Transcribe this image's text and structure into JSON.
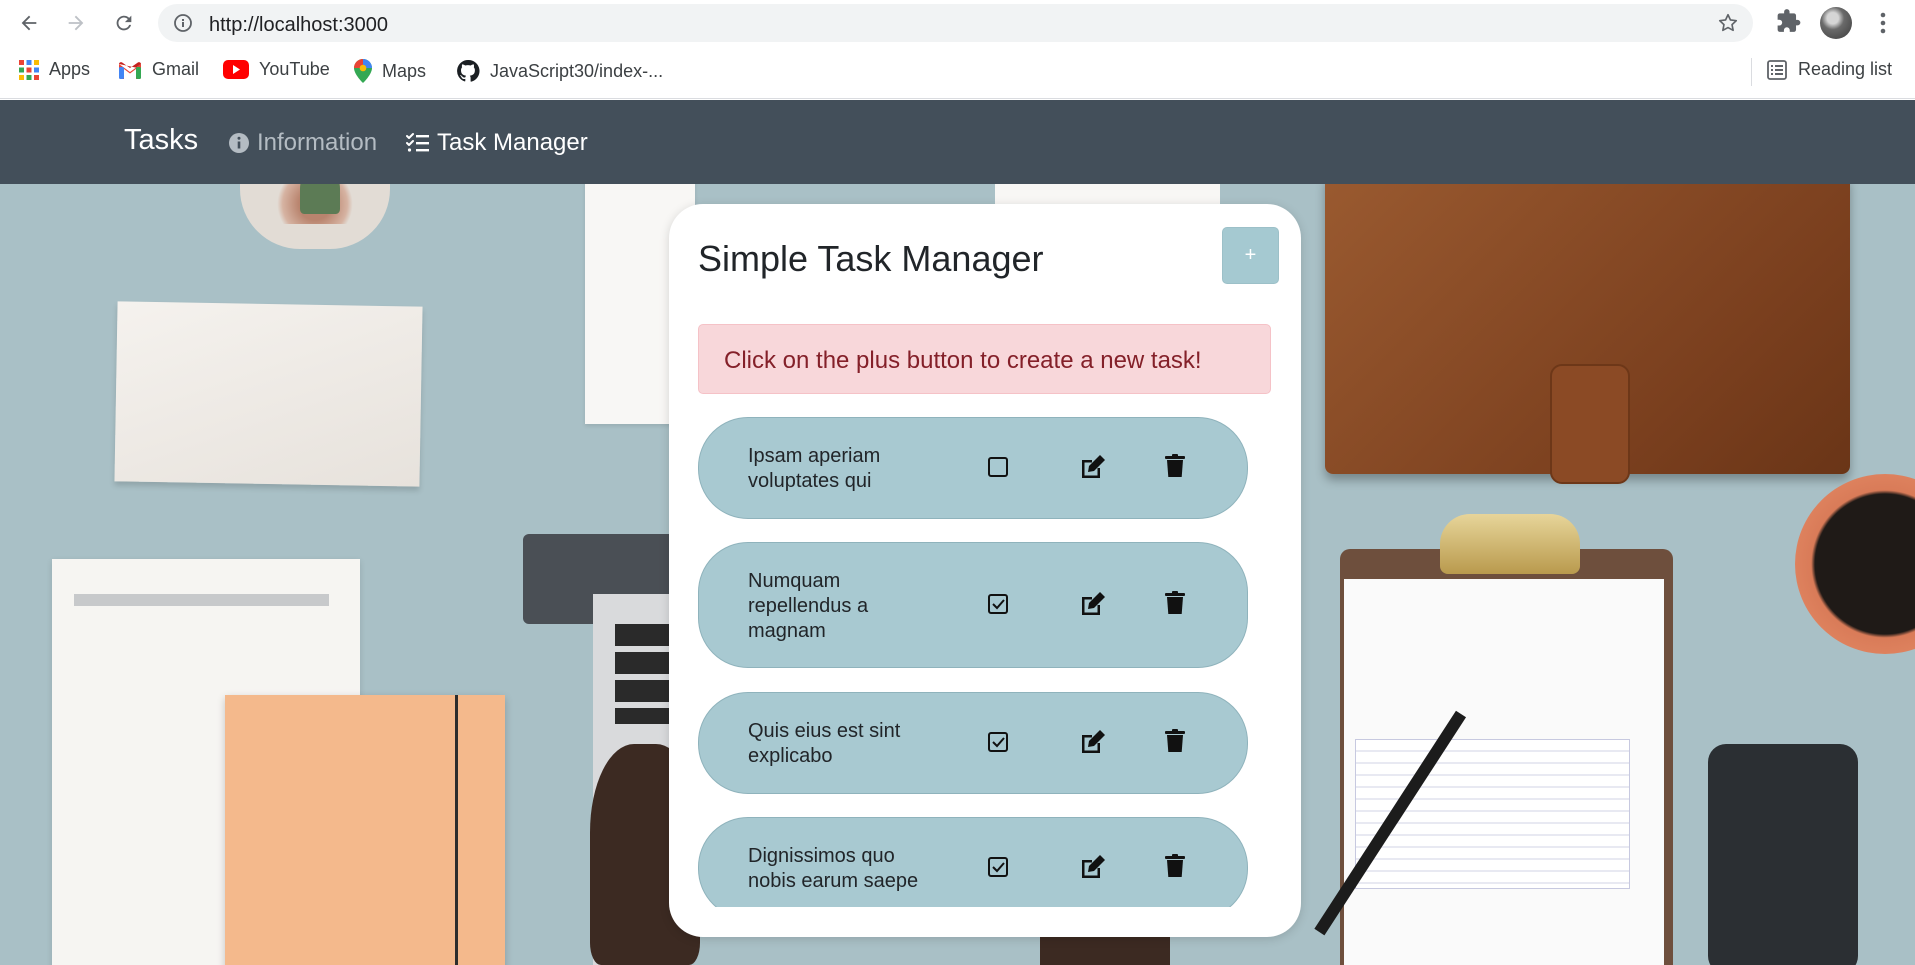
{
  "browser": {
    "url": "http://localhost:3000",
    "bookmarks": [
      "Apps",
      "Gmail",
      "YouTube",
      "Maps",
      "JavaScript30/index-..."
    ],
    "reading_list": "Reading list"
  },
  "navbar": {
    "brand": "Tasks",
    "links": [
      {
        "label": "Information",
        "active": false
      },
      {
        "label": "Task Manager",
        "active": true
      }
    ]
  },
  "manager": {
    "title": "Simple Task Manager",
    "add_label": "+",
    "alert": "Click on the plus button to create a new task!",
    "tasks": [
      {
        "text": "Ipsam aperiam voluptates qui",
        "done": false
      },
      {
        "text": "Numquam repellendus a magnam",
        "done": true
      },
      {
        "text": "Quis eius est sint explicabo",
        "done": true
      },
      {
        "text": "Dignissimos quo nobis earum saepe",
        "done": true
      }
    ]
  },
  "colors": {
    "navbar_bg": "#434f5a",
    "task_bg": "#a8c9d1",
    "alert_bg": "#f8d7da",
    "alert_text": "#842029"
  }
}
